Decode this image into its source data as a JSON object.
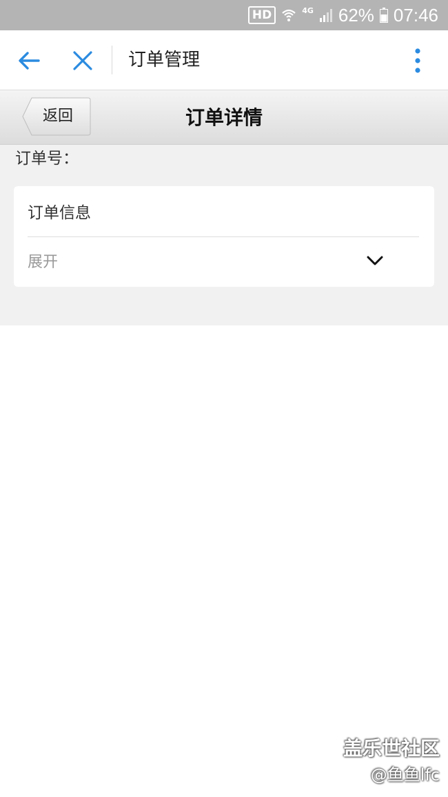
{
  "status_bar": {
    "hd": "HD",
    "network": "4G",
    "battery": "62%",
    "time": "07:46",
    "icons": [
      "wifi-icon",
      "signal-icon",
      "battery-icon"
    ]
  },
  "app_bar": {
    "title": "订单管理",
    "accent_color": "#2b8be0",
    "icons": [
      "back-arrow-icon",
      "close-icon",
      "more-vertical-icon"
    ]
  },
  "nav_bar": {
    "back_label": "返回",
    "title": "订单详情"
  },
  "order": {
    "number_label": "订单号："
  },
  "card": {
    "title": "订单信息",
    "expand_label": "展开",
    "expand_icon": "chevron-down-icon"
  },
  "watermark": {
    "line1": "盖乐世社区",
    "line2": "@鱼鱼lfc"
  }
}
